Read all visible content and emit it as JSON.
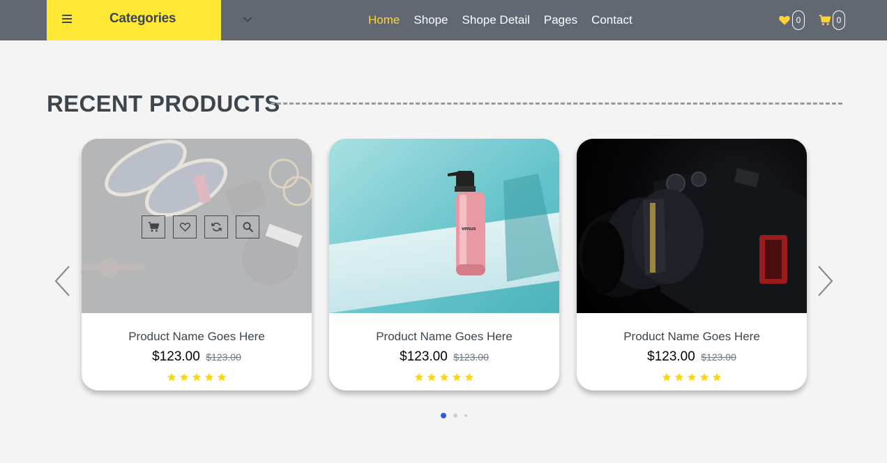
{
  "header": {
    "categories_label": "Categories",
    "nav": [
      {
        "label": "Home",
        "active": true
      },
      {
        "label": "Shope",
        "active": false
      },
      {
        "label": "Shope Detail",
        "active": false
      },
      {
        "label": "Pages",
        "active": false
      },
      {
        "label": "Contact",
        "active": false
      }
    ],
    "wishlist_count": "0",
    "cart_count": "0"
  },
  "section": {
    "title": "RECENT PRODUCTS"
  },
  "products": [
    {
      "name": "Product Name Goes Here",
      "price": "$123.00",
      "old_price": "$123.00",
      "rating": 5,
      "image": "shoes-flatlay"
    },
    {
      "name": "Product Name Goes Here",
      "price": "$123.00",
      "old_price": "$123.00",
      "rating": 5,
      "image": "pink-bottle"
    },
    {
      "name": "Product Name Goes Here",
      "price": "$123.00",
      "old_price": "$123.00",
      "rating": 5,
      "image": "camera"
    }
  ],
  "carousel": {
    "active_page": 1,
    "pages": 3
  },
  "colors": {
    "header_bg": "#626871",
    "accent_yellow": "#ffe834",
    "active_nav": "#ffd333",
    "dot_active": "#2d5be3",
    "star": "#ffd800"
  },
  "icons": {
    "menu": "menu-icon",
    "dropdown": "chevron-down-icon",
    "wishlist": "heart-icon",
    "cart": "cart-icon",
    "prev": "chevron-left-icon",
    "next": "chevron-right-icon",
    "card_actions": [
      "cart-icon",
      "heart-icon",
      "refresh-icon",
      "search-icon"
    ]
  }
}
